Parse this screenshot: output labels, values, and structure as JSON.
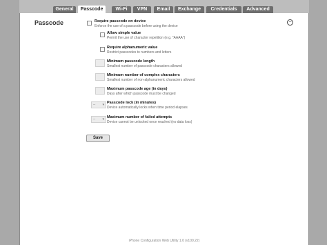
{
  "tabs": [
    {
      "label": "General"
    },
    {
      "label": "Passcode"
    },
    {
      "label": "Wi-Fi"
    },
    {
      "label": "VPN"
    },
    {
      "label": "Email"
    },
    {
      "label": "Exchange"
    },
    {
      "label": "Credentials"
    },
    {
      "label": "Advanced"
    }
  ],
  "section": {
    "title": "Passcode",
    "collapse_symbol": "−"
  },
  "options": {
    "require": {
      "label": "Require passcode on device",
      "desc": "Enforce the use of a passcode before using the device"
    },
    "simple": {
      "label": "Allow simple value",
      "desc": "Permit the use of character repetition (e.g. \"AAAA\")"
    },
    "alnum": {
      "label": "Require alphanumeric value",
      "desc": "Restrict passcodes to numbers and letters"
    },
    "minlen": {
      "label": "Minimum passcode length",
      "desc": "Smallest number of passcode characters allowed"
    },
    "complex": {
      "label": "Minimum number of complex characters",
      "desc": "Smallest number of non-alphanumeric characters allowed"
    },
    "maxage": {
      "label": "Maximum passcode age (in days)",
      "desc": "Days after which passcode must be changed"
    },
    "lock": {
      "label": "Passcode lock (in minutes)",
      "desc": "Device automatically locks when time period elapses",
      "select_value": "--",
      "arrow": "▾"
    },
    "failed": {
      "label": "Maximum number of failed attempts",
      "desc": "Device cannot be unlocked once reached (no data loss)",
      "select_value": "--",
      "arrow": "▾"
    }
  },
  "save_label": "Save",
  "footer": "iPhone Configuration Web Utility 1.0 (v100.22)"
}
